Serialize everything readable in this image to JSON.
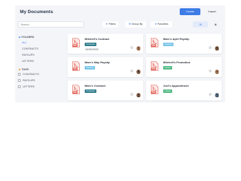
{
  "header": {
    "title": "My Documents",
    "create_label": "Create",
    "import_label": "Import"
  },
  "toolbar": {
    "search_placeholder": "Search...",
    "filters_label": "Filters",
    "group_by_label": "Group By",
    "favorites_label": "Favorites"
  },
  "sidebar": {
    "folders_heading": "FOLDERS",
    "folders": [
      "ALL",
      "CONTRACTS",
      "PAYSLIPS",
      "LETTERS"
    ],
    "tags_heading": "TAGS",
    "tags": [
      "CONTRACTS",
      "PAYSLIPS",
      "LETTERS"
    ]
  },
  "documents": [
    {
      "title": "Mitchell's Contract",
      "tag": "Contracts",
      "tag_color": "#2f7d8c",
      "date": "04/30/2022"
    },
    {
      "title": "Marc's April Payslip",
      "tag": "Payslips",
      "tag_color": "#74c3e8",
      "date": ""
    },
    {
      "title": "Marc's May Payslip",
      "tag": "Payslips",
      "tag_color": "#74c3e8",
      "date": ""
    },
    {
      "title": "Mitchell's Promotion",
      "tag": "Letters",
      "tag_color": "#4fb982",
      "date": ""
    },
    {
      "title": "Marc's Contract",
      "tag": "Contracts",
      "tag_color": "#2f7d8c",
      "date": ""
    },
    {
      "title": "Joel's Appointment",
      "tag": "Letters",
      "tag_color": "#4fb982",
      "date": ""
    }
  ],
  "icons": {
    "pdf": "pdf-file-icon",
    "star": "star-icon",
    "folder": "folder-icon",
    "tag": "tag-icon"
  },
  "colors": {
    "accent": "#3d7be6",
    "pdf_red": "#e05a4e"
  }
}
